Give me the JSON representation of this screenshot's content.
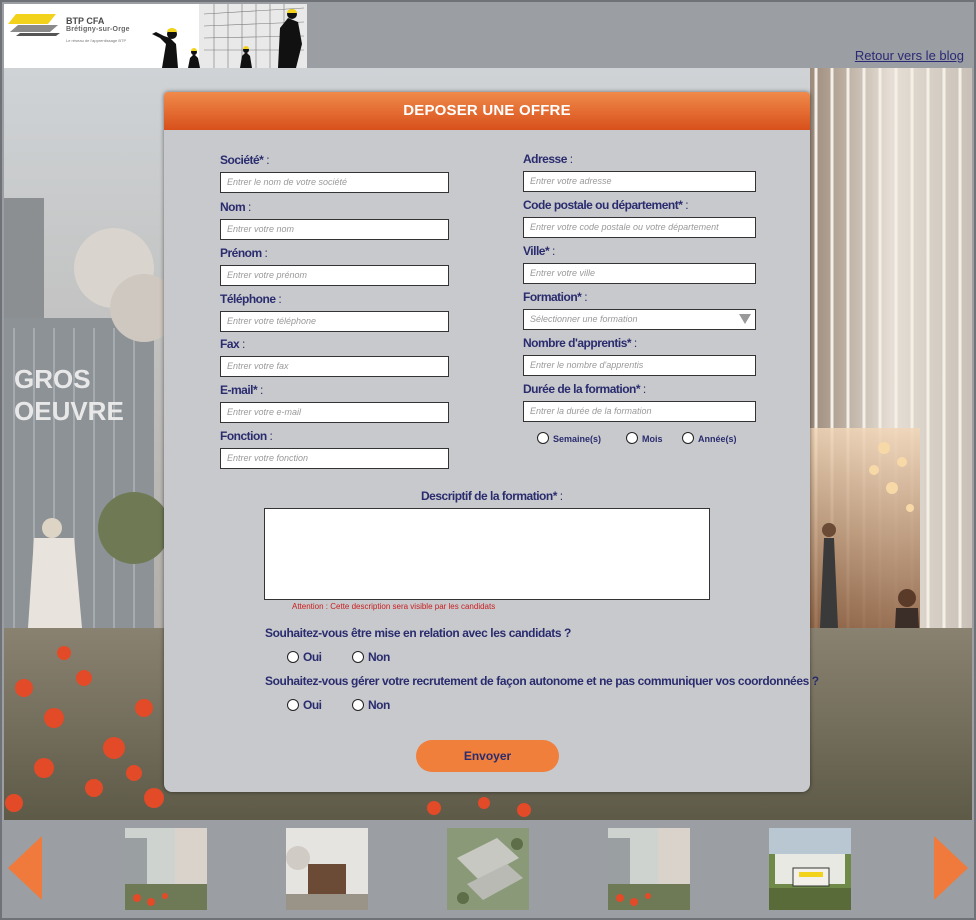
{
  "header": {
    "logo_name": "BTP CFA",
    "logo_sub": "Brétigny-sur-Orge",
    "logo_tag": "Le réseau de l'apprentissage BTP",
    "blog_link": "Retour vers le blog"
  },
  "form": {
    "title": "DEPOSER UNE OFFRE",
    "left": [
      {
        "label": "Société*",
        "placeholder": "Entrer le nom de votre société"
      },
      {
        "label": "Nom",
        "placeholder": "Entrer votre nom"
      },
      {
        "label": "Prénom",
        "placeholder": "Entrer votre prénom"
      },
      {
        "label": "Téléphone",
        "placeholder": "Entrer votre téléphone"
      },
      {
        "label": "Fax",
        "placeholder": "Entrer votre fax"
      },
      {
        "label": "E-mail*",
        "placeholder": "Entrer votre e-mail"
      },
      {
        "label": "Fonction",
        "placeholder": "Entrer votre fonction"
      }
    ],
    "right": [
      {
        "label": "Adresse",
        "placeholder": "Entrer votre adresse"
      },
      {
        "label": "Code postale ou département*",
        "placeholder": "Entrer votre code postale ou votre département"
      },
      {
        "label": "Ville*",
        "placeholder": "Entrer votre ville"
      },
      {
        "label": "Formation*",
        "placeholder": "Sélectionner une formation"
      },
      {
        "label": "Nombre d'apprentis*",
        "placeholder": "Entrer le nombre d'apprentis"
      },
      {
        "label": "Durée de la formation*",
        "placeholder": "Entrer la durée de la formation"
      }
    ],
    "colon": ":",
    "duration_units": [
      "Semaine(s)",
      "Mois",
      "Année(s)"
    ],
    "description_label": "Descriptif de la formation*",
    "description_warning": "Attention : Cette description sera visible par les candidats",
    "question1": "Souhaitez-vous être mise en relation avec les candidats ?",
    "question2": "Souhaitez-vous gérer votre recrutement de façon autonome et ne pas communiquer vos coordonnées ?",
    "yes": "Oui",
    "no": "Non",
    "submit": "Envoyer"
  },
  "scene": {
    "building_sign": "GROS OEUVRE"
  },
  "carousel": {
    "icons": [
      "arrow-left-icon",
      "arrow-right-icon"
    ],
    "accent": "#f07a3c"
  },
  "colors": {
    "accent": "#e8642a",
    "label": "#2a2c6e",
    "warning": "#c81e1e",
    "panel": "#c8c9cd"
  }
}
